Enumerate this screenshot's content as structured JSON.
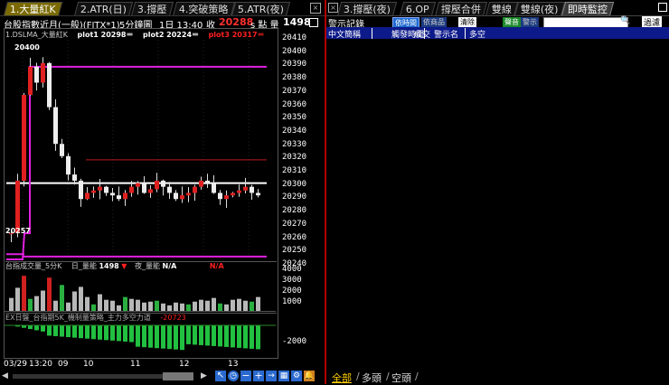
{
  "left": {
    "tabs": [
      "1.大量紅K",
      "2.ATR(日)",
      "3.撐壓",
      "4.突破策略",
      "5.ATR(夜)"
    ],
    "active_tab": 0,
    "header": {
      "symbol": "台股指數近月(一般)(FITX*1)",
      "interval": "5分鐘圖",
      "day_time": "1日 13:40",
      "close_label": "收",
      "close_value": "20288",
      "volume_label": "s 點  量",
      "volume_value": "1498"
    },
    "legend": {
      "name": "1.DSLMA_大量紅K",
      "p1": "plot1 20298＝",
      "p2": "plot2 20224＝",
      "p3": "plot3 20317＝"
    },
    "price_labels": [
      "20410",
      "20400",
      "20390",
      "20380",
      "20370",
      "20360",
      "20350",
      "20340",
      "20330",
      "20320",
      "20310",
      "20300",
      "20290",
      "20280",
      "20270",
      "20260",
      "20250",
      "20240"
    ],
    "high_tag": "20400",
    "low_tag": "20257",
    "vol_header": {
      "name": "台指成交量_5分K",
      "day_label": "日_量能",
      "day_value": "1498",
      "night_label": "夜_量能",
      "night_value": "N/A",
      "extra_value": "N/A"
    },
    "vol_labels": [
      "4000",
      "3000",
      "2000",
      "1000"
    ],
    "osc_header": "EX日盤_台指期5K_機制量策略_主力多空力道",
    "osc_value": "-20723",
    "osc_labels": [
      "-2000"
    ],
    "time_labels": [
      "03/29",
      "13:20",
      "09",
      "10",
      "11",
      "12",
      "13"
    ]
  },
  "chart_data": [
    {
      "type": "candlestick",
      "title": "",
      "ylim": [
        20235,
        20415
      ],
      "plots": {
        "plot1": 20298,
        "plot2": 20224,
        "plot3": 20317
      },
      "candles_close_approx": [
        20257,
        20300,
        20370,
        20393,
        20380,
        20396,
        20360,
        20330,
        20320,
        20305,
        20300,
        20285,
        20290,
        20292,
        20295,
        20290,
        20288,
        20285,
        20290,
        20295,
        20298,
        20290,
        20293,
        20300,
        20295,
        20290,
        20285,
        20288,
        20290,
        20295,
        20300,
        20298,
        20290,
        20285,
        20288,
        20290,
        20292,
        20295,
        20290,
        20288
      ]
    },
    {
      "type": "bar",
      "title": "台指成交量_5分K",
      "ylim": [
        0,
        4500
      ]
    },
    {
      "type": "bar",
      "title": "主力多空力道",
      "ylim": [
        -2500,
        0
      ]
    }
  ],
  "right": {
    "tabs": [
      "3.撐壓(夜)",
      "6.OP",
      "撐壓合併",
      "雙線",
      "雙線(夜)",
      "即時監控"
    ],
    "active_tab": 5,
    "title": "警示記錄",
    "btn_group1": "依時間",
    "btn_group2": "依商品",
    "btn_clear": "清除",
    "btn_sound": "聲音",
    "btn_warn": "警示",
    "btn_filter": "過濾",
    "columns": [
      "中文簡稱",
      "觸發時間",
      "成交",
      "警示名稱",
      "多空"
    ],
    "bottom_tabs": [
      "全部",
      "多頭",
      "空頭"
    ]
  }
}
